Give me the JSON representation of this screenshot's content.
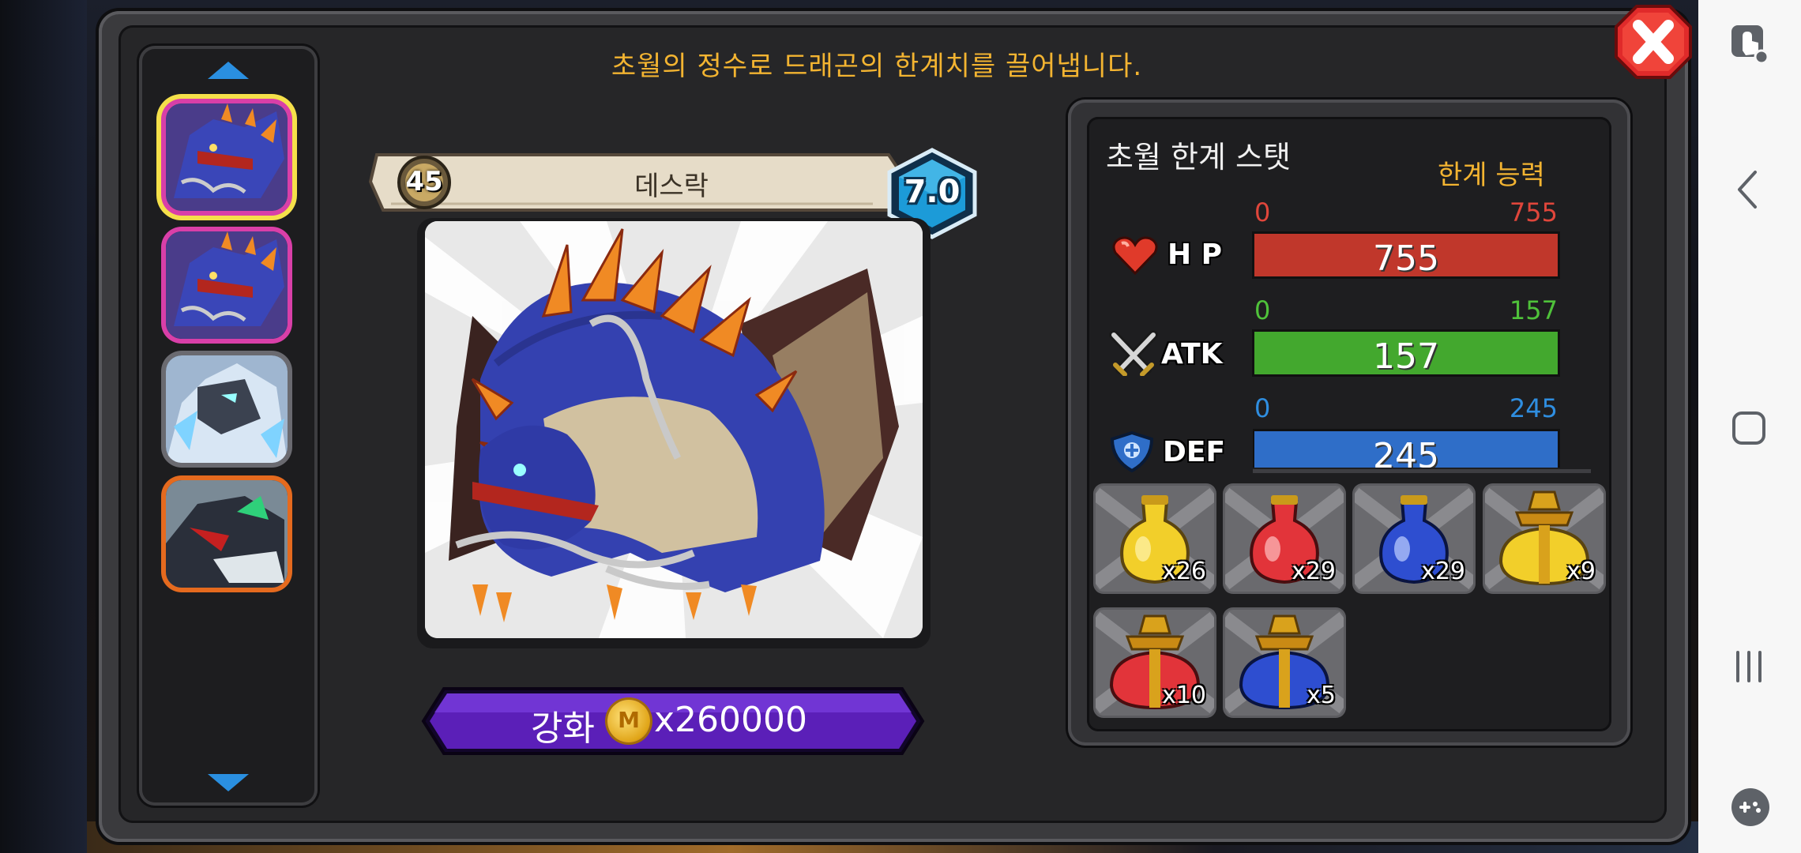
{
  "header": {
    "description": "초월의 정수로 드래곤의 한계치를 끌어냅니다."
  },
  "dragon_list": [
    {
      "name": "dragon-thumb-1"
    },
    {
      "name": "dragon-thumb-2"
    },
    {
      "name": "dragon-thumb-3"
    },
    {
      "name": "dragon-thumb-4"
    }
  ],
  "dragon": {
    "level": "45",
    "name": "데스락",
    "grade": "7.0"
  },
  "enhance": {
    "label": "강화",
    "coin_symbol": "M",
    "cost": "x260000"
  },
  "stats_panel": {
    "title": "초월 한계 스탯",
    "limit_label": "한계 능력",
    "stats": [
      {
        "key": "hp",
        "name": "H P",
        "min": "0",
        "max": "755",
        "value": "755",
        "fill": 1.0,
        "color": "#c0372b"
      },
      {
        "key": "atk",
        "name": "ATK",
        "min": "0",
        "max": "157",
        "value": "157",
        "fill": 1.0,
        "color": "#43a82e"
      },
      {
        "key": "def",
        "name": "DEF",
        "min": "0",
        "max": "245",
        "value": "245",
        "fill": 1.0,
        "color": "#2f6ec8"
      }
    ]
  },
  "items": [
    {
      "icon": "yellow-potion-icon",
      "count": "x26"
    },
    {
      "icon": "red-potion-icon",
      "count": "x29"
    },
    {
      "icon": "blue-potion-icon",
      "count": "x29"
    },
    {
      "icon": "gold-flask-icon",
      "count": "x9"
    },
    {
      "icon": "red-flask-icon",
      "count": "x10"
    },
    {
      "icon": "blue-flask-icon",
      "count": "x5"
    }
  ],
  "colors": {
    "accent_gold": "#f3b431",
    "enhance_button": "#5b1fb8",
    "panel_bg": "#262628"
  }
}
